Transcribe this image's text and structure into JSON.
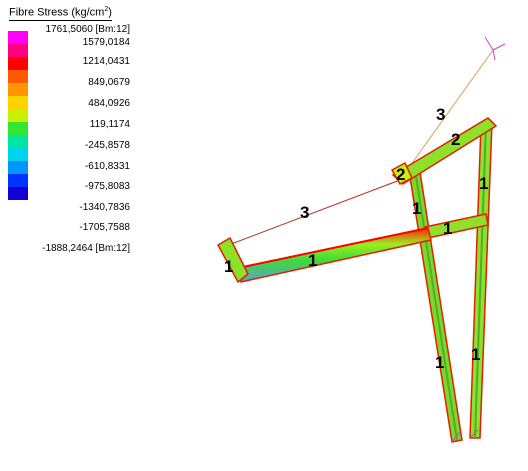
{
  "legend": {
    "title": "Fibre Stress (kg/cm",
    "title_sup": "2",
    "title_end": ")",
    "labels": [
      "1761,5060 [Bm:12]",
      "1579,0184",
      "1214,0431",
      "849,0679",
      "484,0926",
      "119,1174",
      "-245,8578",
      "-610,8331",
      "-975,8083",
      "-1340,7836",
      "-1705,7588",
      "-1888,2464 [Bm:12]"
    ],
    "colors": [
      "#ff00ff",
      "#ff007f",
      "#ff0000",
      "#ff5a00",
      "#ff9600",
      "#ffd200",
      "#c8f000",
      "#32e632",
      "#00e6a0",
      "#00d2f0",
      "#0096ff",
      "#0032ff",
      "#1400d2"
    ]
  },
  "members": {
    "labels": [
      "1",
      "1",
      "2",
      "1",
      "1",
      "1",
      "1",
      "2",
      "3",
      "3"
    ]
  }
}
